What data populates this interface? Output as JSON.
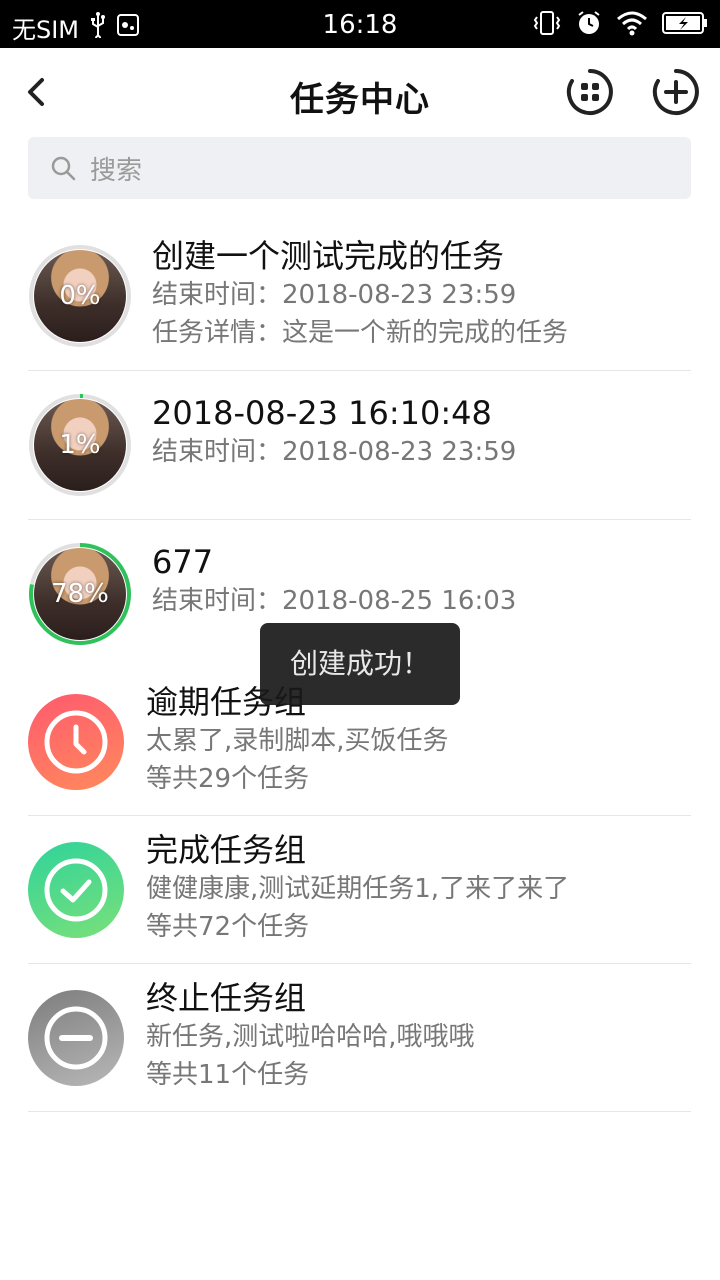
{
  "status_bar": {
    "carrier": "无SIM",
    "time": "16:18"
  },
  "header": {
    "title": "任务中心"
  },
  "search": {
    "placeholder": "搜索"
  },
  "tasks": [
    {
      "avatar_progress": 0,
      "progress_label": "0%",
      "title": "创建一个测试完成的任务",
      "end_time": "结束时间：2018-08-23 23:59",
      "detail": "任务详情：这是一个新的完成的任务"
    },
    {
      "avatar_progress": 1,
      "progress_label": "1%",
      "title": "2018-08-23 16:10:48",
      "end_time": "结束时间：2018-08-23 23:59"
    },
    {
      "avatar_progress": 78,
      "progress_label": "78%",
      "title": "677",
      "end_time": "结束时间：2018-08-25 16:03"
    }
  ],
  "groups": [
    {
      "title": "逾期任务组",
      "summary": "太累了,录制脚本,买饭任务",
      "count": "等共29个任务",
      "icon": "clock-icon",
      "color_from": "#ff5a6e",
      "color_to": "#ff8a5c"
    },
    {
      "title": "完成任务组",
      "summary": "健健康康,测试延期任务1,了来了来了",
      "count": "等共72个任务",
      "icon": "check-icon",
      "color_from": "#2fd39a",
      "color_to": "#7be07a"
    },
    {
      "title": "终止任务组",
      "summary": "新任务,测试啦哈哈哈,哦哦哦",
      "count": "等共11个任务",
      "icon": "minus-icon",
      "color_from": "#7d7d7d",
      "color_to": "#b8b8b8"
    }
  ],
  "toast": {
    "message": "创建成功！"
  },
  "colors": {
    "progress_ring": "#2fc25b",
    "ring_track": "#e0e0e0"
  }
}
